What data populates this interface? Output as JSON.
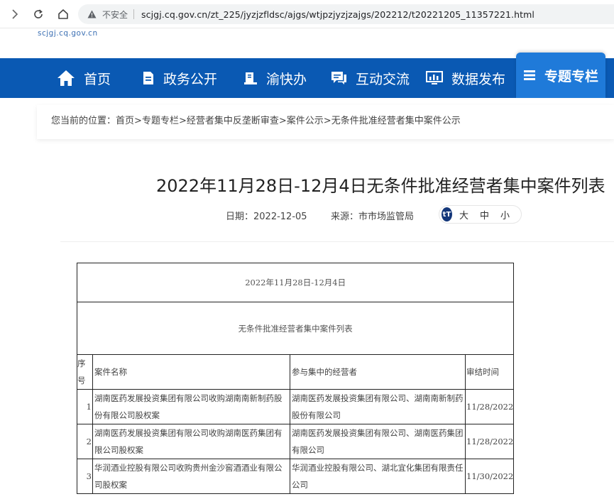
{
  "browser": {
    "not_secure": "不安全",
    "url": "scjgj.cq.gov.cn/zt_225/jyzjzfldsc/ajgs/wtjpzjyzjzajgs/202212/t20221205_11357221.html"
  },
  "site": {
    "domain": "scjgj.cq.gov.cn"
  },
  "nav": {
    "items": [
      {
        "label": "首页",
        "icon": "home-icon"
      },
      {
        "label": "政务公开",
        "icon": "document-icon"
      },
      {
        "label": "渝快办",
        "icon": "book-icon"
      },
      {
        "label": "互动交流",
        "icon": "chat-icon"
      },
      {
        "label": "数据发布",
        "icon": "chart-monitor-icon"
      },
      {
        "label": "专题专栏",
        "icon": "list-icon"
      }
    ],
    "active": "专题专栏",
    "color": "#0a59b3",
    "active_color": "#1f7ad9"
  },
  "breadcrumb": {
    "label": "您当前的位置：",
    "items": [
      "首页",
      "专题专栏",
      "经营者集中反垄断审查",
      "案件公示",
      "无条件批准经营者集中案件公示"
    ],
    "separator": ">"
  },
  "article": {
    "title": "2022年11月28日-12月4日无条件批准经营者集中案件列表",
    "date_label": "日期：",
    "date": "2022-12-05",
    "source_label": "来源：",
    "source": "市市场监管局",
    "font_size_icon": "tT",
    "font_sizes": [
      "大",
      "中",
      "小"
    ]
  },
  "table": {
    "period": "2022年11月28日-12月4日",
    "caption": "无条件批准经营者集中案件列表",
    "headers": {
      "no": [
        "序",
        "号"
      ],
      "name": "案件名称",
      "parties": "参与集中的经营者",
      "time": "审结时间"
    },
    "rows": [
      {
        "no": "1",
        "name": "湖南医药发展投资集团有限公司收购湖南南新制药股份有限公司股权案",
        "parties": "湖南医药发展投资集团有限公司、湖南南新制药股份有限公司",
        "time": "11/28/2022"
      },
      {
        "no": "2",
        "name": "湖南医药发展投资集团有限公司收购湖南医药集团有限公司股权案",
        "parties": "湖南医药发展投资集团有限公司、湖南医药集团有限公司",
        "time": "11/28/2022"
      },
      {
        "no": "3",
        "name": "华润酒业控股有限公司收购贵州金沙窖酒酒业有限公司股权案",
        "parties": "华润酒业控股有限公司、湖北宜化集团有限责任公司",
        "time": "11/30/2022"
      }
    ]
  }
}
